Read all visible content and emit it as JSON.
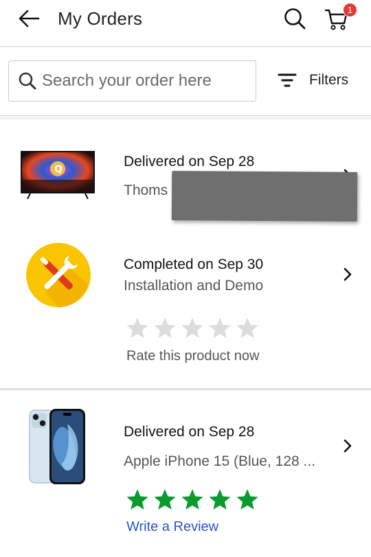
{
  "header": {
    "title": "My Orders",
    "cart_badge_count": "1",
    "icons": {
      "back": "arrow-left-icon",
      "search": "search-icon",
      "cart": "cart-icon"
    }
  },
  "search": {
    "placeholder": "Search your order here",
    "filters_label": "Filters"
  },
  "orders": [
    {
      "status": "Delivered on Sep 28",
      "product": "Thoms",
      "product_redacted": true,
      "thumb": "tv-thumbnail"
    },
    {
      "status": "Completed on Sep 30",
      "product": "Installation and Demo",
      "thumb": "tools-icon",
      "rating": 0,
      "rate_prompt": "Rate this product now"
    },
    {
      "status": "Delivered on Sep 28",
      "product": "Apple iPhone 15 (Blue, 128 ...",
      "thumb": "phone-thumbnail",
      "rating": 5,
      "review_link": "Write a Review"
    }
  ],
  "colors": {
    "star_filled": "#0a9a2f",
    "star_empty": "#dcdcdc",
    "link": "#2a55c5",
    "badge": "#e53935",
    "tool_circle": "#f9c400"
  }
}
